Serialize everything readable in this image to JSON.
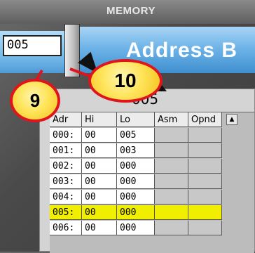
{
  "header": {
    "title": "MEMORY"
  },
  "address_bus": {
    "label": "Address B"
  },
  "address_input": {
    "value": "005"
  },
  "callouts": {
    "nine": "9",
    "ten": "10"
  },
  "memory": {
    "current": "005",
    "columns": [
      "Adr",
      "Hi",
      "Lo",
      "Asm",
      "Opnd"
    ],
    "scroll_up_icon": "▲",
    "rows": [
      {
        "adr": "000:",
        "hi": "00",
        "lo": "005",
        "asm": "",
        "opnd": ""
      },
      {
        "adr": "001:",
        "hi": "00",
        "lo": "003",
        "asm": "",
        "opnd": ""
      },
      {
        "adr": "002:",
        "hi": "00",
        "lo": "000",
        "asm": "",
        "opnd": ""
      },
      {
        "adr": "003:",
        "hi": "00",
        "lo": "000",
        "asm": "",
        "opnd": ""
      },
      {
        "adr": "004:",
        "hi": "00",
        "lo": "000",
        "asm": "",
        "opnd": ""
      },
      {
        "adr": "005:",
        "hi": "00",
        "lo": "000",
        "asm": "",
        "opnd": ""
      },
      {
        "adr": "006:",
        "hi": "00",
        "lo": "000",
        "asm": "",
        "opnd": ""
      }
    ],
    "highlight_row": 5,
    "highlight_color": "#f0ef00"
  }
}
